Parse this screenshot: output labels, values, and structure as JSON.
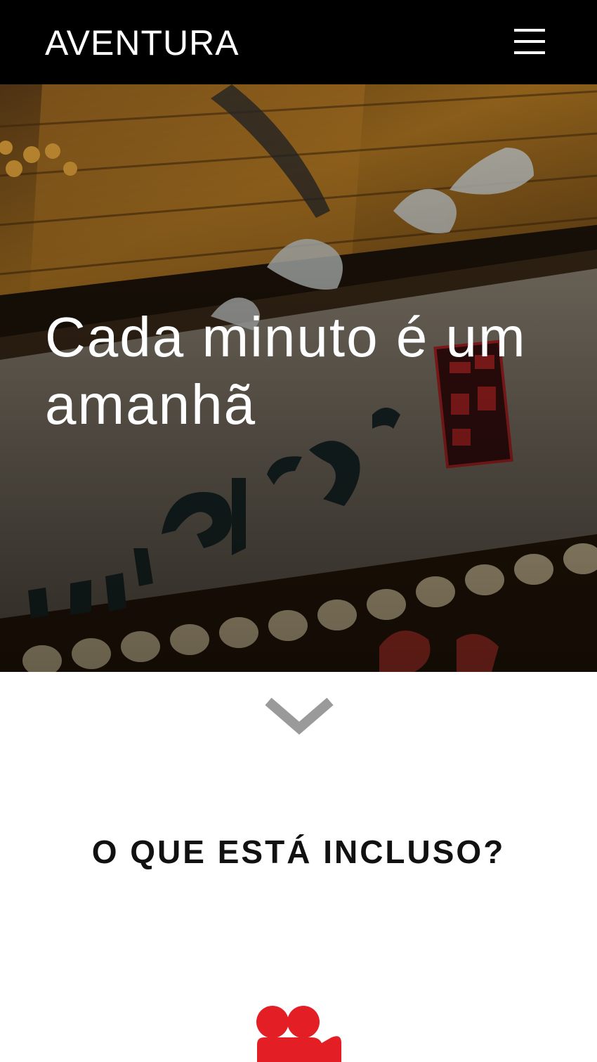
{
  "header": {
    "brand": "AVENTURA",
    "menu_icon": "hamburger-menu-icon"
  },
  "hero": {
    "title": "Cada minuto é um amanhã",
    "image_description_icon": "japanese-street-signboard-photo"
  },
  "scroll_indicator": {
    "icon": "chevron-down-icon",
    "color": "#9a9a9a"
  },
  "included_section": {
    "heading": "O QUE ESTÁ INCLUSO?",
    "first_feature_icon": "group-people-icon",
    "accent_color": "#e31e24"
  }
}
